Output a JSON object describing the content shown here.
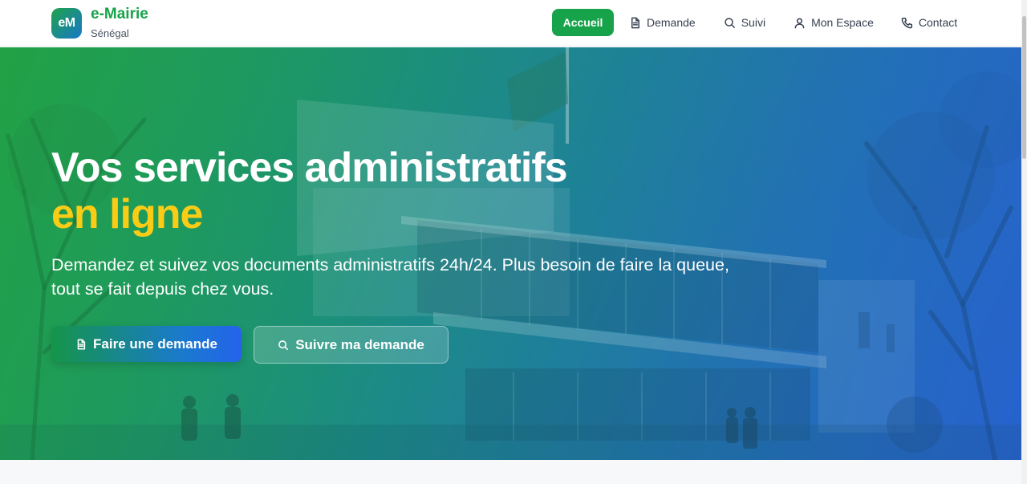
{
  "brand": {
    "logo_text": "eM",
    "title": "e-Mairie",
    "subtitle": "Sénégal"
  },
  "nav": {
    "active": "Accueil",
    "items": [
      {
        "label": "Demande",
        "icon": "document-icon"
      },
      {
        "label": "Suivi",
        "icon": "search-icon"
      },
      {
        "label": "Mon Espace",
        "icon": "user-icon"
      },
      {
        "label": "Contact",
        "icon": "phone-icon"
      }
    ]
  },
  "hero": {
    "title_line1": "Vos services administratifs",
    "title_line2": "en ligne",
    "description": "Demandez et suivez vos documents administratifs 24h/24. Plus besoin de faire la queue, tout se fait depuis chez vous.",
    "primary_button": {
      "label": "Faire une demande",
      "icon": "document-icon"
    },
    "secondary_button": {
      "label": "Suivre ma demande",
      "icon": "search-icon"
    }
  },
  "colors": {
    "brand_green": "#16a34a",
    "accent_yellow": "#facc15",
    "brand_blue": "#2563eb"
  }
}
